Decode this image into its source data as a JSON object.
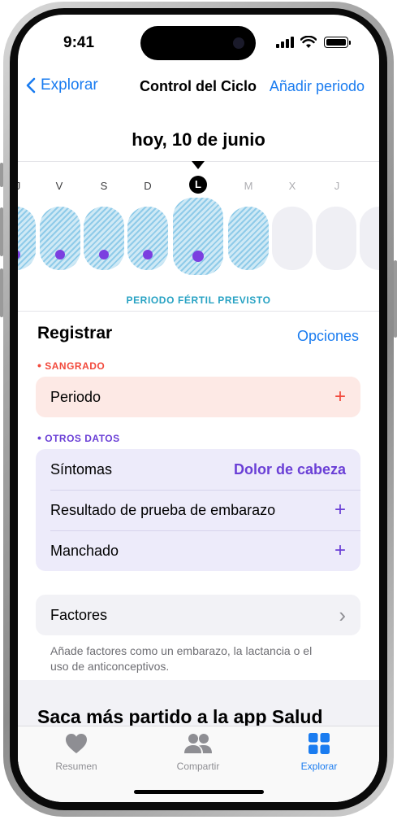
{
  "status_bar": {
    "time": "9:41"
  },
  "nav": {
    "back_label": "Explorar",
    "title": "Control del Ciclo",
    "action_label": "Añadir periodo"
  },
  "calendar": {
    "date_title": "hoy, 10 de junio",
    "days": [
      "J",
      "V",
      "S",
      "D",
      "L",
      "M",
      "X",
      "J"
    ],
    "today_letter": "L",
    "fertile_label": "PERIODO FÉRTIL PREVISTO"
  },
  "register": {
    "title": "Registrar",
    "options_label": "Opciones",
    "bleeding_label": "SANGRADO",
    "bleeding_bullet": "•",
    "period_label": "Periodo",
    "plus": "+",
    "other_label": "OTROS DATOS",
    "other_bullet": "•",
    "rows": [
      {
        "label": "Síntomas",
        "value": "Dolor de cabeza"
      },
      {
        "label": "Resultado de prueba de embarazo",
        "value": "+"
      },
      {
        "label": "Manchado",
        "value": "+"
      }
    ],
    "factors_label": "Factores",
    "factors_chevron": "›",
    "note": "Añade factores como un embarazo, la lactancia o el uso de anticonceptivos."
  },
  "promo": {
    "title": "Saca más partido a la app Salud"
  },
  "tabs": [
    {
      "label": "Resumen",
      "icon": "heart-icon"
    },
    {
      "label": "Compartir",
      "icon": "people-icon"
    },
    {
      "label": "Explorar",
      "icon": "grid-icon"
    }
  ],
  "colors": {
    "accent": "#1a7cf0",
    "fertile": "#27a2c3",
    "bleeding": "#f24a3d",
    "other": "#6a3fd6"
  }
}
